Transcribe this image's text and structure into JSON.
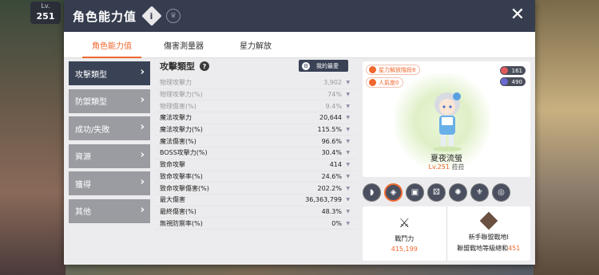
{
  "hud": {
    "level_label": "Lv.",
    "level_value": "251"
  },
  "window": {
    "title": "角色能力值",
    "close_label": "✕"
  },
  "tabs": [
    {
      "label": "角色能力值",
      "active": true
    },
    {
      "label": "傷害測量器",
      "active": false
    },
    {
      "label": "星力解放",
      "active": false
    }
  ],
  "sidebar": {
    "items": [
      {
        "label": "攻擊類型",
        "active": true
      },
      {
        "label": "防禦類型",
        "active": false
      },
      {
        "label": "成功/失敗",
        "active": false
      },
      {
        "label": "資源",
        "active": false
      },
      {
        "label": "獲得",
        "active": false
      },
      {
        "label": "其他",
        "active": false
      }
    ]
  },
  "stats": {
    "heading": "攻擊類型",
    "favorite_label": "我的最愛",
    "rows": [
      {
        "label": "物理攻擊力",
        "value": "3,902",
        "dim": true
      },
      {
        "label": "物理攻擊力(%)",
        "value": "74%",
        "dim": true
      },
      {
        "label": "物理傷害(%)",
        "value": "9.4%",
        "dim": true
      },
      {
        "label": "魔法攻擊力",
        "value": "20,644",
        "dim": false
      },
      {
        "label": "魔法攻擊力(%)",
        "value": "115.5%",
        "dim": false
      },
      {
        "label": "魔法傷害(%)",
        "value": "96.6%",
        "dim": false
      },
      {
        "label": "BOSS攻擊力(%)",
        "value": "30.4%",
        "dim": false
      },
      {
        "label": "致命攻擊",
        "value": "414",
        "dim": false
      },
      {
        "label": "致命攻擊率(%)",
        "value": "24.6%",
        "dim": false
      },
      {
        "label": "致命攻擊傷害(%)",
        "value": "202.2%",
        "dim": false
      },
      {
        "label": "最大傷害",
        "value": "36,363,799",
        "dim": false
      },
      {
        "label": "最終傷害(%)",
        "value": "48.3%",
        "dim": false
      },
      {
        "label": "無視防禦率(%)",
        "value": "0%",
        "dim": false
      }
    ]
  },
  "character": {
    "star_badge": "星力解放階段8",
    "popularity": "人氣度0",
    "count_a": "161",
    "count_b": "490",
    "name": "夏夜流螢",
    "level": "Lv.251",
    "job": "菈菈"
  },
  "cards": {
    "power_label": "戰鬥力",
    "power_value": "415,199",
    "union_label": "新手聯盟戰地Ⅰ",
    "union_sub": "聯盟戰地等級總和",
    "union_value": "451"
  },
  "colors": {
    "accent": "#f0672f",
    "dark": "#363d4f"
  }
}
